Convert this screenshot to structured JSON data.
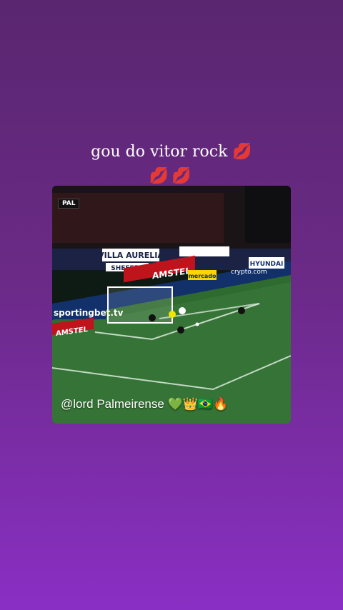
{
  "story": {
    "caption_line1": "gou do vitor rock 💋",
    "caption_line2": "💋💋",
    "media": {
      "scorebug": "PAL",
      "handle_text": "@lord Palmeirense 💚👑🇧🇷🔥",
      "ad_boards": [
        "VILLA AURELIA",
        "SHEFFER",
        "HYUNDAI",
        "AMSTEL",
        "sportingbet.tv",
        "crypto.com",
        "mercado"
      ]
    }
  }
}
